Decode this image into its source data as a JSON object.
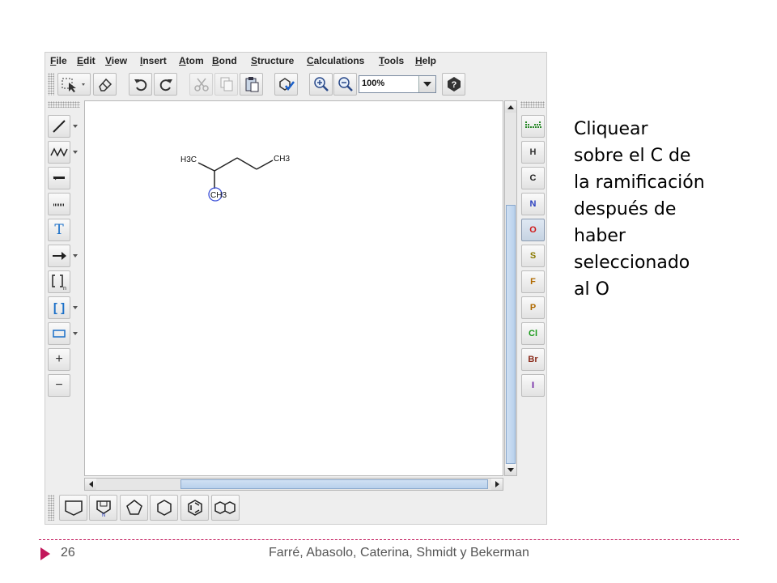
{
  "menu": [
    {
      "label": "File"
    },
    {
      "label": "Edit"
    },
    {
      "label": "View"
    },
    {
      "label": "Insert"
    },
    {
      "label": "Atom"
    },
    {
      "label": "Bond"
    },
    {
      "label": "Structure"
    },
    {
      "label": "Calculations"
    },
    {
      "label": "Tools"
    },
    {
      "label": "Help"
    }
  ],
  "toolbar": {
    "zoom_value": "100%"
  },
  "left_tools": [
    {
      "icon": "single-bond-icon"
    },
    {
      "icon": "chain-icon"
    },
    {
      "icon": "bold-bond-icon"
    },
    {
      "icon": "dashed-bond-icon"
    },
    {
      "icon": "text-icon",
      "label": "T"
    },
    {
      "icon": "arrow-icon"
    },
    {
      "icon": "repeat-bracket-icon"
    },
    {
      "icon": "bracket-icon",
      "label": "[ ]"
    },
    {
      "icon": "rectangle-icon"
    },
    {
      "icon": "plus-icon",
      "label": "+"
    },
    {
      "icon": "minus-icon",
      "label": "−"
    }
  ],
  "elements": [
    {
      "symbol": "H",
      "color": "#333333"
    },
    {
      "symbol": "C",
      "color": "#222222"
    },
    {
      "symbol": "N",
      "color": "#2a3fbf"
    },
    {
      "symbol": "O",
      "color": "#d01818",
      "selected": true
    },
    {
      "symbol": "S",
      "color": "#8a7a00"
    },
    {
      "symbol": "F",
      "color": "#b06a00"
    },
    {
      "symbol": "P",
      "color": "#b06a00"
    },
    {
      "symbol": "Cl",
      "color": "#1a9a1a"
    },
    {
      "symbol": "Br",
      "color": "#8a2a1a"
    },
    {
      "symbol": "I",
      "color": "#6a1aa0"
    }
  ],
  "molecule": {
    "labels": [
      "H3C",
      "CH3",
      "CH3"
    ],
    "highlight_color": "#3b4fd8"
  },
  "instructions": {
    "lines": [
      "Cliquear",
      "sobre el C de",
      "la ramificación",
      "después de",
      "haber",
      "seleccionado",
      "al O"
    ]
  },
  "footer": {
    "page_number": "26",
    "authors": "Farré, Abasolo, Caterina, Shmidt y Bekerman",
    "accent_color": "#c2185b"
  }
}
